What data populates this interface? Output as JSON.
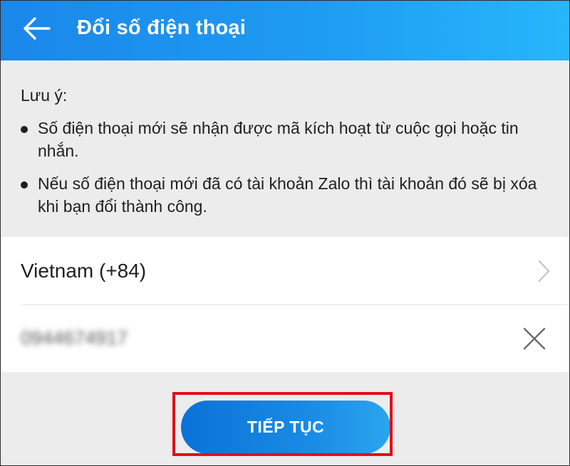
{
  "header": {
    "title": "Đổi số điện thoại",
    "back_icon": "arrow-left-icon"
  },
  "notes": {
    "heading": "Lưu ý:",
    "items": [
      "Số điện thoại mới sẽ nhận được mã kích hoạt từ cuộc gọi hoặc tin nhắn.",
      "Nếu số điện thoại mới đã có tài khoản Zalo thì tài khoản đó sẽ bị xóa khi bạn đổi thành công."
    ]
  },
  "form": {
    "country": "Vietnam (+84)",
    "country_icon": "chevron-right-icon",
    "phone_value": "0944674917",
    "clear_icon": "close-icon"
  },
  "actions": {
    "continue_label": "TIẾP TỤC"
  },
  "colors": {
    "header_start": "#1a87ea",
    "header_end": "#27b6fb",
    "button": "#1a8ae4",
    "highlight": "#e0101a",
    "background": "#ececec"
  }
}
